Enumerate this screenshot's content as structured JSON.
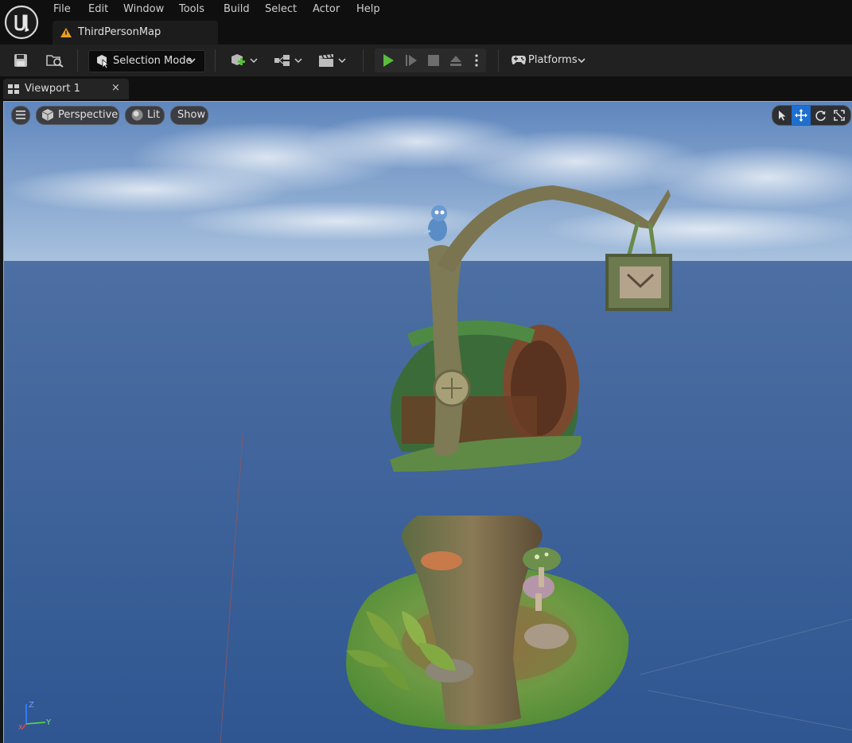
{
  "menu": {
    "items": [
      "File",
      "Edit",
      "Window",
      "Tools",
      "Build",
      "Select",
      "Actor",
      "Help"
    ]
  },
  "map_tab": {
    "label": "ThirdPersonMap"
  },
  "toolbar": {
    "selection_mode_label": "Selection Mode",
    "platforms_label": "Platforms"
  },
  "viewport_tab": {
    "label": "Viewport 1",
    "close": "×"
  },
  "viewport": {
    "perspective_label": "Perspective",
    "lit_label": "Lit",
    "show_label": "Show"
  },
  "axis_labels": {
    "z": "Z",
    "y": "Y",
    "x": "X"
  },
  "colors": {
    "play": "#5bbd3c",
    "active_tool": "#1f6fd1",
    "viewport_border": "#d9a441",
    "warning": "#e8a020"
  }
}
